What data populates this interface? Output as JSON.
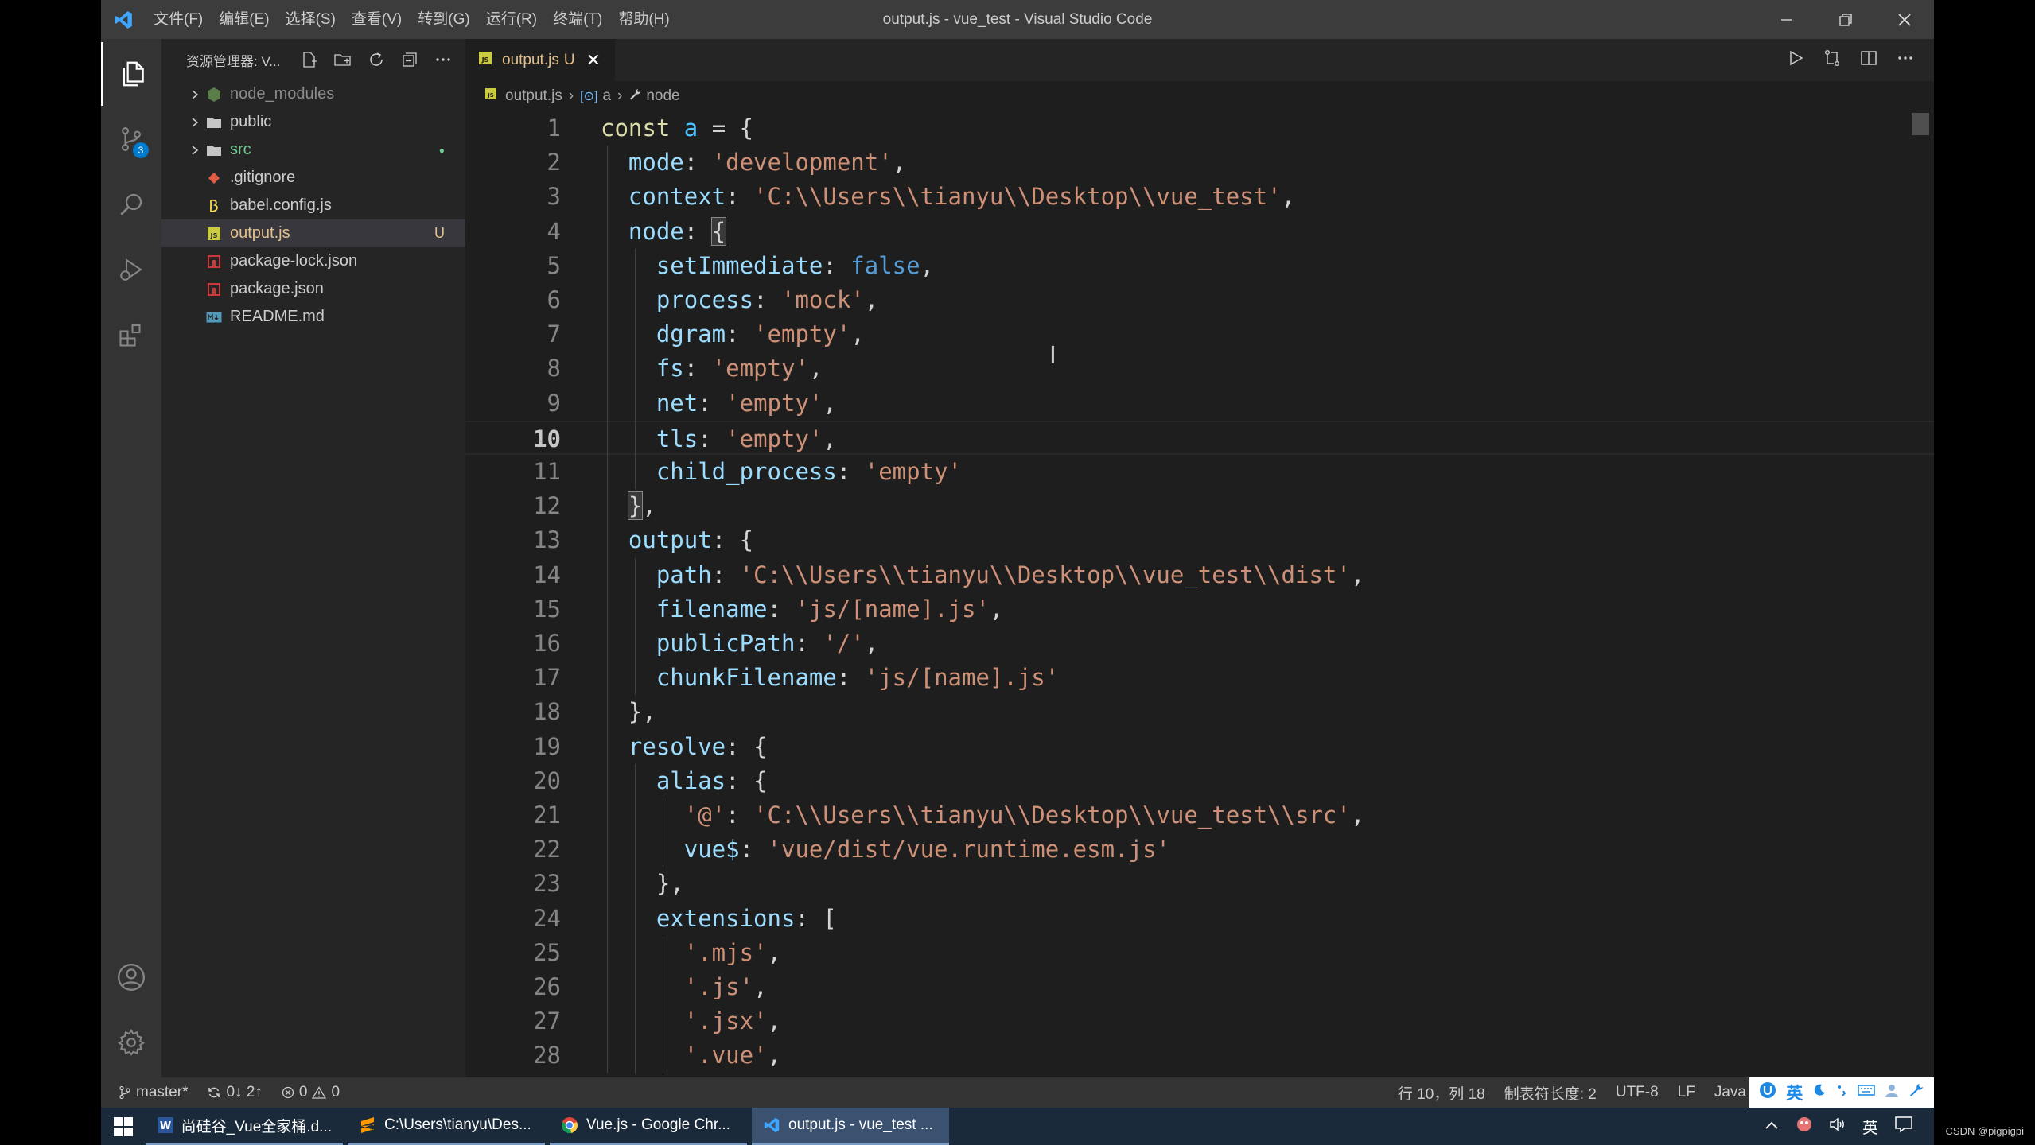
{
  "window": {
    "title": "output.js - vue_test - Visual Studio Code",
    "menu": [
      "文件(F)",
      "编辑(E)",
      "选择(S)",
      "查看(V)",
      "转到(G)",
      "运行(R)",
      "终端(T)",
      "帮助(H)"
    ]
  },
  "activity_bar": {
    "scm_badge": "3"
  },
  "sidebar": {
    "title": "资源管理器: V...",
    "items": [
      {
        "label": "node_modules",
        "type": "folder",
        "deco": ""
      },
      {
        "label": "public",
        "type": "folder",
        "deco": ""
      },
      {
        "label": "src",
        "type": "folder",
        "deco": "●"
      },
      {
        "label": ".gitignore",
        "type": "git",
        "deco": ""
      },
      {
        "label": "babel.config.js",
        "type": "babel",
        "deco": ""
      },
      {
        "label": "output.js",
        "type": "js",
        "deco": "U"
      },
      {
        "label": "package-lock.json",
        "type": "json",
        "deco": ""
      },
      {
        "label": "package.json",
        "type": "json",
        "deco": ""
      },
      {
        "label": "README.md",
        "type": "md",
        "deco": ""
      }
    ]
  },
  "tab": {
    "icon_text": "JS",
    "label": "output.js",
    "status": "U",
    "close": "✕"
  },
  "breadcrumb": {
    "file": "output.js",
    "symbol1": "a",
    "symbol2": "node"
  },
  "editor": {
    "current_line": 10,
    "lines": [
      "const a = {",
      "  mode: 'development',",
      "  context: 'C:\\\\Users\\\\tianyu\\\\Desktop\\\\vue_test',",
      "  node: {",
      "    setImmediate: false,",
      "    process: 'mock',",
      "    dgram: 'empty',",
      "    fs: 'empty',",
      "    net: 'empty',",
      "    tls: 'empty',",
      "    child_process: 'empty'",
      "  },",
      "  output: {",
      "    path: 'C:\\\\Users\\\\tianyu\\\\Desktop\\\\vue_test\\\\dist',",
      "    filename: 'js/[name].js',",
      "    publicPath: '/',",
      "    chunkFilename: 'js/[name].js'",
      "  },",
      "  resolve: {",
      "    alias: {",
      "      '@': 'C:\\\\Users\\\\tianyu\\\\Desktop\\\\vue_test\\\\src',",
      "      vue$: 'vue/dist/vue.runtime.esm.js'",
      "    },",
      "    extensions: [",
      "      '.mjs',",
      "      '.js',",
      "      '.jsx',",
      "      '.vue',"
    ]
  },
  "status_bar": {
    "branch": "master*",
    "sync": "0↓ 2↑",
    "errors": "0",
    "warnings": "0",
    "position": "行 10，列 18",
    "tab_size": "制表符长度: 2",
    "encoding": "UTF-8",
    "eol": "LF",
    "language": "Java",
    "ime_lang": "英"
  },
  "taskbar": {
    "tasks": [
      {
        "label": "尚硅谷_Vue全家桶.d...",
        "app": "word"
      },
      {
        "label": "C:\\Users\\tianyu\\Des...",
        "app": "sublime"
      },
      {
        "label": "Vue.js - Google Chr...",
        "app": "chrome"
      },
      {
        "label": "output.js - vue_test ...",
        "app": "vscode"
      }
    ],
    "tray_lang": "英",
    "watermark": "CSDN @pigpigpi"
  },
  "colors": {
    "accent": "#007acc",
    "modified": "#e2c08d",
    "untracked": "#73c991"
  }
}
